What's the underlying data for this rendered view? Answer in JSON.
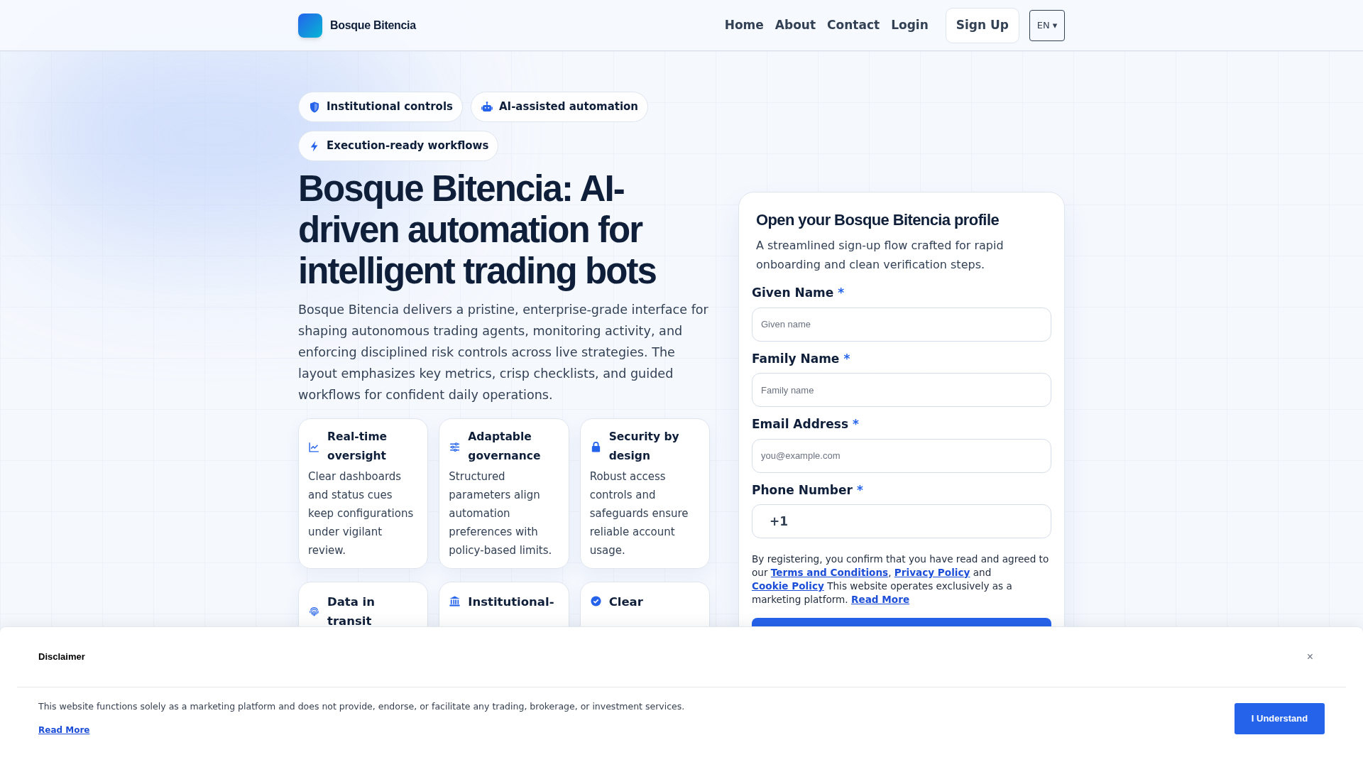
{
  "header": {
    "brand": "Bosque Bitencia",
    "nav": [
      "Home",
      "About",
      "Contact",
      "Login"
    ],
    "signup": "Sign Up",
    "language": "EN ▾"
  },
  "hero": {
    "badges": [
      {
        "kind": "shield",
        "label": "Institutional controls"
      },
      {
        "kind": "robot",
        "label": "AI-assisted automation"
      },
      {
        "kind": "bolt",
        "label": "Execution-ready workflows"
      }
    ],
    "title": "Bosque Bitencia: AI-driven automation for intelligent trading bots",
    "description": "Bosque Bitencia delivers a pristine, enterprise-grade interface for shaping autonomous trading agents, monitoring activity, and enforcing disciplined risk controls across live strategies. The layout emphasizes key metrics, crisp checklists, and guided workflows for confident daily operations.",
    "features": [
      {
        "kind": "chart",
        "title": "Real-time oversight",
        "text": "Clear dashboards and status cues keep configurations under vigilant review."
      },
      {
        "kind": "sliders",
        "title": "Adaptable governance",
        "text": "Structured parameters align automation preferences with policy-based limits."
      },
      {
        "kind": "lock",
        "title": "Security by design",
        "text": "Robust access controls and safeguards ensure reliable account usage."
      },
      {
        "kind": "fingerprint",
        "title": "Data in transit"
      },
      {
        "kind": "bank",
        "title": "Institutional-"
      },
      {
        "kind": "check",
        "title": "Clear"
      }
    ]
  },
  "form": {
    "title": "Open your Bosque Bitencia profile",
    "subtitle": "A streamlined sign-up flow crafted for rapid onboarding and clean verification steps.",
    "fields": [
      {
        "label": "Given Name",
        "required_mark": "*",
        "placeholder": "Given name"
      },
      {
        "label": "Family Name",
        "required_mark": "*",
        "placeholder": "Family name"
      },
      {
        "label": "Email Address",
        "required_mark": "*",
        "placeholder": "you@example.com"
      },
      {
        "label": "Phone Number",
        "required_mark": "*",
        "value": "+1"
      }
    ],
    "consent": [
      {
        "text": "By registering, you confirm that you have read and agreed to our "
      },
      {
        "link": "Terms and Conditions"
      },
      {
        "text": ", "
      },
      {
        "link": "Privacy Policy"
      },
      {
        "text": " and "
      },
      {
        "link": "Cookie Policy"
      },
      {
        "text": " This website operates exclusively as a marketing platform. "
      },
      {
        "link": "Read More"
      }
    ]
  },
  "disclaimer": {
    "title": "Disclaimer",
    "close": "×",
    "text": "This website functions solely as a marketing platform and does not provide, endorse, or facilitate any trading, brokerage, or investment services.",
    "link": "Read More",
    "button": "I Understand"
  }
}
